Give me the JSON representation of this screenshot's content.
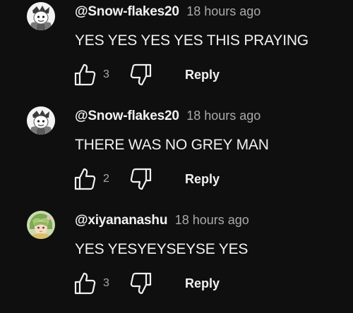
{
  "theme": {
    "background": "#0f0f0f",
    "text": "#f1f1f1",
    "secondary_text": "#aaaaaa"
  },
  "comments": [
    {
      "author": "@Snow-flakes20",
      "time": "18 hours ago",
      "text": "YES YES YES YES THIS PRAYING",
      "likes": "3",
      "reply_label": "Reply",
      "avatar_icon": "snow-flakes-avatar"
    },
    {
      "author": "@Snow-flakes20",
      "time": "18 hours ago",
      "text": "THERE WAS NO GREY MAN",
      "likes": "2",
      "reply_label": "Reply",
      "avatar_icon": "snow-flakes-avatar"
    },
    {
      "author": "@xiyananashu",
      "time": "18 hours ago",
      "text": "YES YESYEYSEYSE YES",
      "likes": "3",
      "reply_label": "Reply",
      "avatar_icon": "xiyananashu-avatar"
    }
  ]
}
